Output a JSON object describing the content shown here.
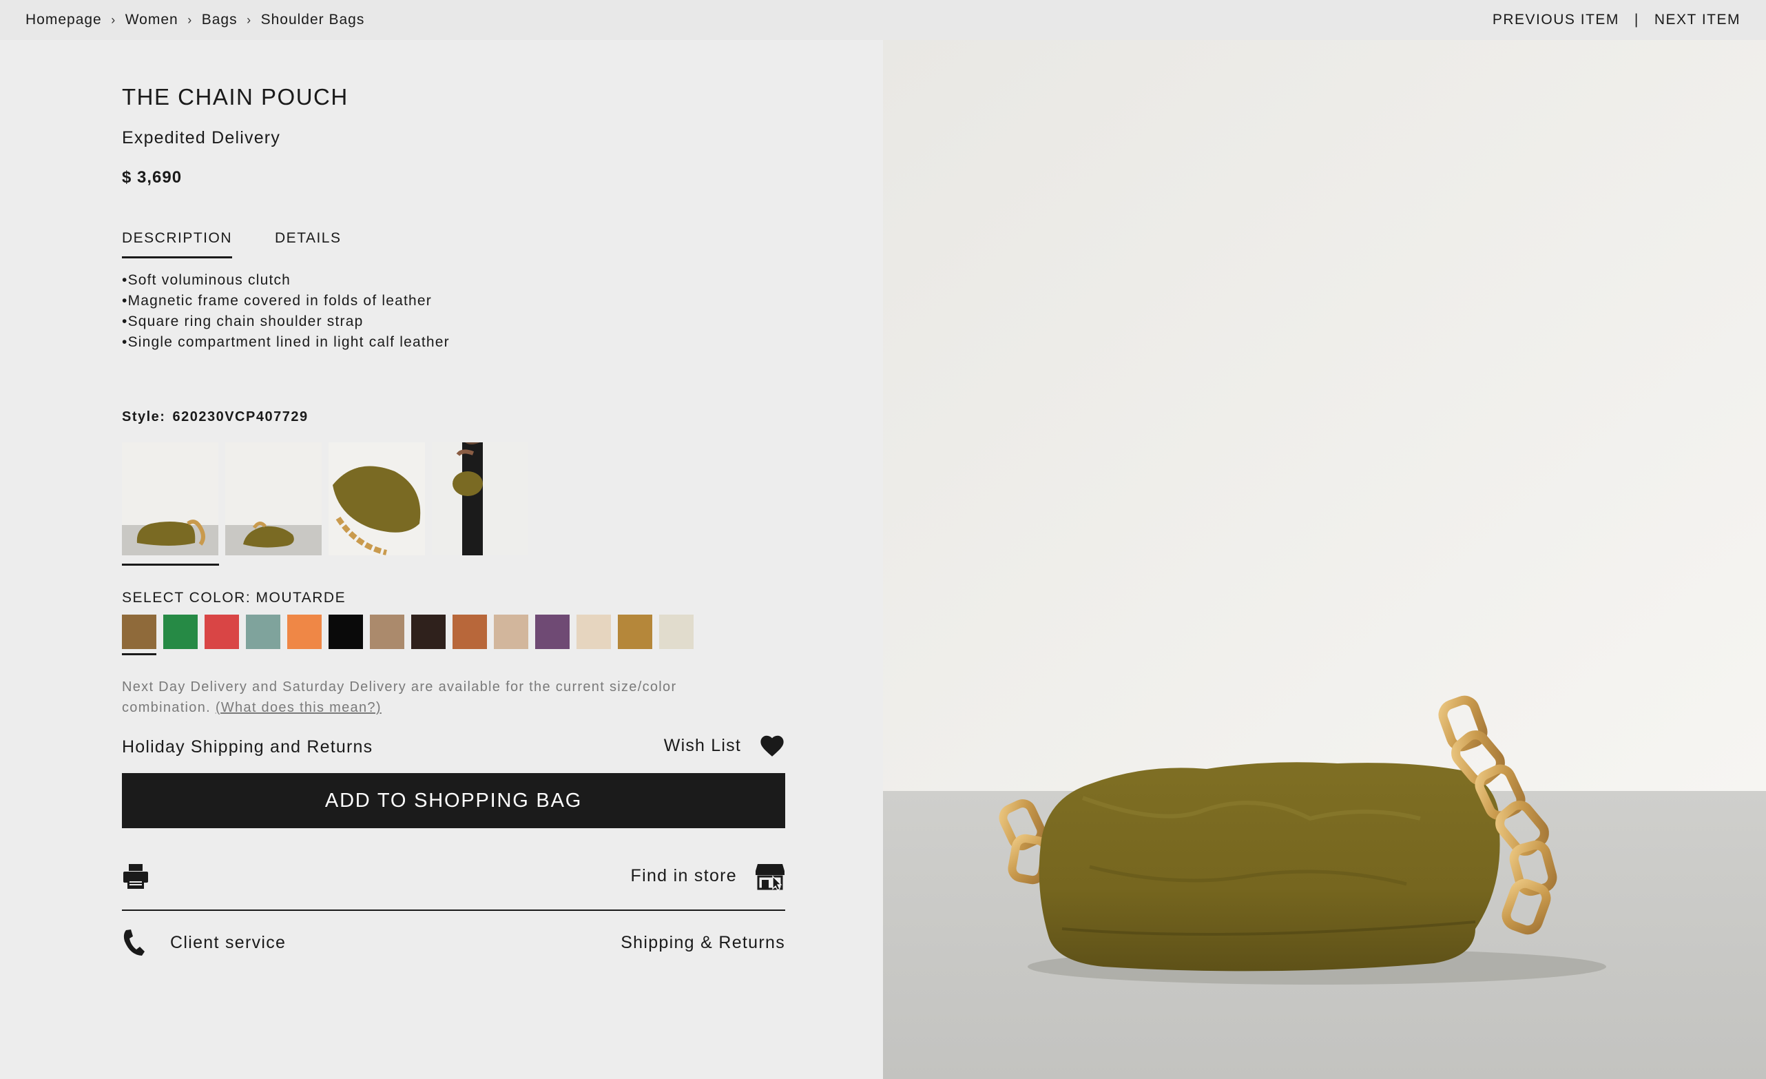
{
  "breadcrumb": {
    "items": [
      "Homepage",
      "Women",
      "Bags",
      "Shoulder Bags"
    ]
  },
  "item_nav": {
    "previous": "PREVIOUS ITEM",
    "divider": "|",
    "next": "NEXT ITEM"
  },
  "product": {
    "title": "THE CHAIN POUCH",
    "delivery": "Expedited Delivery",
    "price": "$ 3,690"
  },
  "tabs": [
    {
      "label": "DESCRIPTION",
      "active": true
    },
    {
      "label": "DETAILS",
      "active": false
    }
  ],
  "description": [
    "Soft voluminous clutch",
    "Magnetic frame covered in folds of leather",
    "Square ring chain shoulder strap",
    "Single compartment lined in light calf leather"
  ],
  "style": {
    "label": "Style:",
    "value": "620230VCP407729"
  },
  "thumbnails": [
    "front-view",
    "angle-view",
    "top-view",
    "model-view"
  ],
  "color": {
    "label": "SELECT COLOR: MOUTARDE",
    "swatches": [
      "#8f6a3a",
      "#268a45",
      "#d94545",
      "#7fa39c",
      "#ef8746",
      "#0a0a0a",
      "#ab8a6c",
      "#2f211c",
      "#b8673a",
      "#d2b69c",
      "#6f4a74",
      "#e6d5bf",
      "#b5873a",
      "#e1dccd"
    ],
    "selected_index": 0
  },
  "notice": {
    "text": "Next Day Delivery and Saturday Delivery are available for the current size/color combination.",
    "link": "(What does this mean?)"
  },
  "links": {
    "holiday": "Holiday Shipping and Returns",
    "wishlist": "Wish List",
    "add_to_bag": "ADD TO SHOPPING BAG",
    "find_in_store": "Find in store",
    "client_service": "Client service",
    "shipping_returns": "Shipping & Returns"
  },
  "icons": {
    "chevron": "chevron-right-icon",
    "heart": "heart-icon",
    "print": "print-icon",
    "store": "store-icon",
    "phone": "phone-icon"
  },
  "colors": {
    "button_bg": "#1b1b1b",
    "page_bg": "#ededed",
    "bag_olive": "#7a6a23",
    "chain_gold": "#c99a4d"
  }
}
